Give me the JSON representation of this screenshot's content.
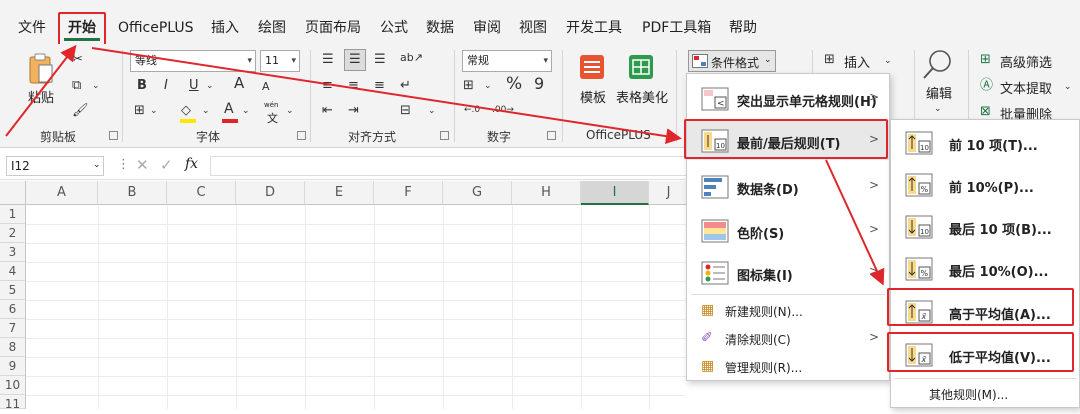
{
  "menubar": {
    "tabs": [
      {
        "label": "文件"
      },
      {
        "label": "开始"
      },
      {
        "label": "OfficePLUS"
      },
      {
        "label": "插入"
      },
      {
        "label": "绘图"
      },
      {
        "label": "页面布局"
      },
      {
        "label": "公式"
      },
      {
        "label": "数据"
      },
      {
        "label": "审阅"
      },
      {
        "label": "视图"
      },
      {
        "label": "开发工具"
      },
      {
        "label": "PDF工具箱"
      },
      {
        "label": "帮助"
      }
    ]
  },
  "ribbon": {
    "clipboard": {
      "paste": "粘贴",
      "label": "剪贴板"
    },
    "font": {
      "name": "等线",
      "size": "11",
      "label": "字体",
      "bold": "B",
      "italic": "I",
      "underline": "U",
      "grow": "A",
      "shrink": "A",
      "color_a": "A",
      "wen": "wén",
      "wen2": "文"
    },
    "align": {
      "label": "对齐方式"
    },
    "number": {
      "format": "常规",
      "percent": "%",
      "comma": "9",
      "label": "数字"
    },
    "officeplus": {
      "template": "模板",
      "beautify": "表格美化",
      "label": "OfficePLUS"
    },
    "cond_format": "条件格式",
    "insert": "插入",
    "edit": "编辑",
    "right": {
      "adv_filter": "高级筛选",
      "text_extract": "文本提取",
      "batch_delete": "批量删除"
    }
  },
  "formulabar": {
    "namebox": "I12",
    "fx": "fx"
  },
  "columns": [
    "A",
    "B",
    "C",
    "D",
    "E",
    "F",
    "G",
    "H",
    "I",
    "J"
  ],
  "rows": [
    "1",
    "2",
    "3",
    "4",
    "5",
    "6",
    "7",
    "8",
    "9",
    "10",
    "11"
  ],
  "cf_menu": {
    "items": [
      {
        "label": "突出显示单元格规则(H)"
      },
      {
        "label": "最前/最后规则(T)"
      },
      {
        "label": "数据条(D)"
      },
      {
        "label": "色阶(S)"
      },
      {
        "label": "图标集(I)"
      }
    ],
    "small": [
      {
        "label": "新建规则(N)..."
      },
      {
        "label": "清除规则(C)"
      },
      {
        "label": "管理规则(R)..."
      }
    ]
  },
  "sub_menu": {
    "items": [
      {
        "label": "前 10 项(T)...",
        "icon": "10"
      },
      {
        "label": "前 10%(P)...",
        "icon": "%"
      },
      {
        "label": "最后 10 项(B)...",
        "icon": "10"
      },
      {
        "label": "最后 10%(O)...",
        "icon": "%"
      },
      {
        "label": "高于平均值(A)...",
        "icon": "x̄"
      },
      {
        "label": "低于平均值(V)...",
        "icon": "x̄"
      }
    ],
    "more": "其他规则(M)..."
  },
  "colors": {
    "accent": "#217346",
    "highlight": "#e0262b",
    "menu_bg": "#f3f3f3"
  }
}
